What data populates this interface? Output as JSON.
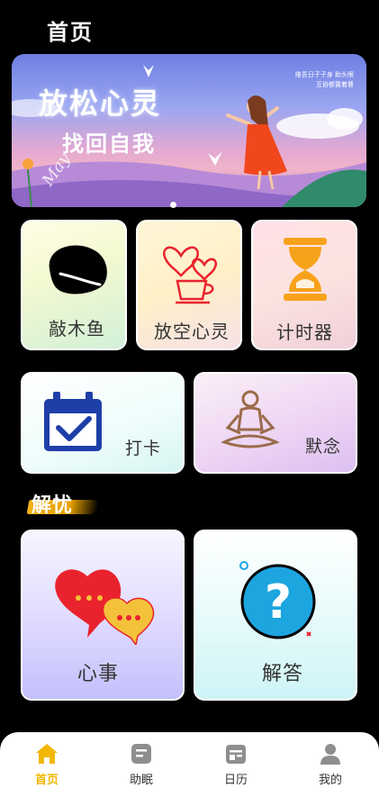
{
  "header": {
    "title": "首页"
  },
  "banner": {
    "line1": "放松心灵",
    "line2": "找回自我",
    "small_text": "维吾日子子身 助头眼互协都置着曹",
    "cursive": "May",
    "active_index": 0
  },
  "tiles": {
    "muyu": "敲木鱼",
    "fangkong": "放空心灵",
    "timer": "计时器",
    "daka": "打卡",
    "monian": "默念"
  },
  "section": {
    "title": "解忧"
  },
  "cards": {
    "xinshi": "心事",
    "jieda": "解答"
  },
  "nav": {
    "items": [
      {
        "label": "首页",
        "icon": "home-icon",
        "active": true
      },
      {
        "label": "助眠",
        "icon": "sleep-aid-icon",
        "active": false
      },
      {
        "label": "日历",
        "icon": "calendar-icon",
        "active": false
      },
      {
        "label": "我的",
        "icon": "user-icon",
        "active": false
      }
    ]
  },
  "colors": {
    "accent": "#f2b705",
    "background": "#000000",
    "check_blue": "#1e3ea8",
    "timer_orange": "#f7a21b",
    "heart_red": "#e9232d"
  }
}
